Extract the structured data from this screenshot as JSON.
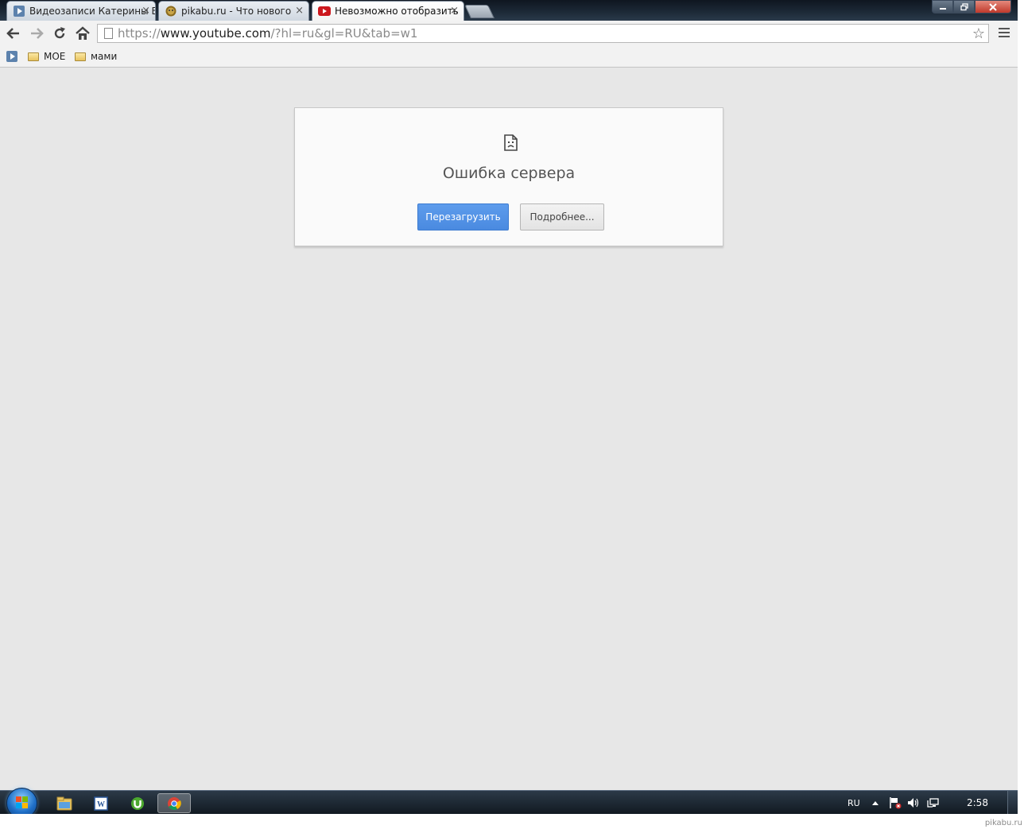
{
  "browser": {
    "tabs": [
      {
        "title": "Видеозаписи Катерины В",
        "favicon": "video-play-icon",
        "active": false
      },
      {
        "title": "pikabu.ru - Что нового",
        "favicon": "pikabu-icon",
        "active": false
      },
      {
        "title": "Невозможно отобразить",
        "favicon": "youtube-icon",
        "active": true
      }
    ],
    "tab_close_glyph": "×",
    "address": {
      "scheme": "https://",
      "host": "www.youtube.com",
      "rest": "/?hl=ru&gl=RU&tab=w1"
    },
    "star_glyph": "☆",
    "bookmarks": [
      {
        "label": "",
        "icon": "video-play-icon"
      },
      {
        "label": "МОЕ",
        "icon": "folder-icon"
      },
      {
        "label": "мами",
        "icon": "folder-icon"
      }
    ]
  },
  "error_page": {
    "title": "Ошибка сервера",
    "reload_label": "Перезагрузить",
    "details_label": "Подробнее..."
  },
  "taskbar": {
    "language": "RU",
    "clock": "2:58",
    "pinned": [
      "explorer-icon",
      "word-icon",
      "utorrent-icon",
      "chrome-icon"
    ]
  },
  "watermark": "pikabu.ru",
  "colors": {
    "accent_button": "#4a8ae0",
    "content_bg": "#e7e7e7",
    "youtube_red": "#cc181e"
  }
}
